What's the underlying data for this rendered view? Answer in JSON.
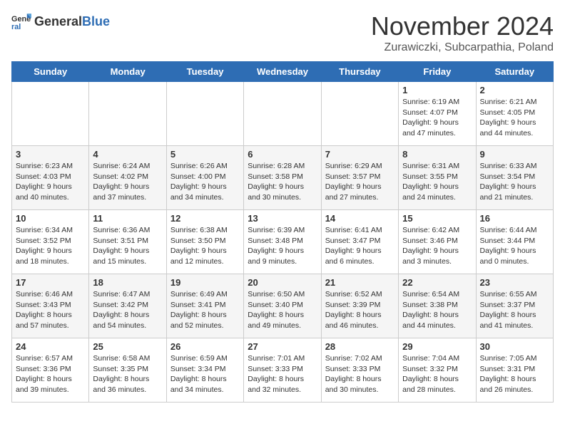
{
  "header": {
    "logo_general": "General",
    "logo_blue": "Blue",
    "month": "November 2024",
    "location": "Zurawiczki, Subcarpathia, Poland"
  },
  "days_of_week": [
    "Sunday",
    "Monday",
    "Tuesday",
    "Wednesday",
    "Thursday",
    "Friday",
    "Saturday"
  ],
  "weeks": [
    [
      {
        "day": "",
        "info": ""
      },
      {
        "day": "",
        "info": ""
      },
      {
        "day": "",
        "info": ""
      },
      {
        "day": "",
        "info": ""
      },
      {
        "day": "",
        "info": ""
      },
      {
        "day": "1",
        "info": "Sunrise: 6:19 AM\nSunset: 4:07 PM\nDaylight: 9 hours and 47 minutes."
      },
      {
        "day": "2",
        "info": "Sunrise: 6:21 AM\nSunset: 4:05 PM\nDaylight: 9 hours and 44 minutes."
      }
    ],
    [
      {
        "day": "3",
        "info": "Sunrise: 6:23 AM\nSunset: 4:03 PM\nDaylight: 9 hours and 40 minutes."
      },
      {
        "day": "4",
        "info": "Sunrise: 6:24 AM\nSunset: 4:02 PM\nDaylight: 9 hours and 37 minutes."
      },
      {
        "day": "5",
        "info": "Sunrise: 6:26 AM\nSunset: 4:00 PM\nDaylight: 9 hours and 34 minutes."
      },
      {
        "day": "6",
        "info": "Sunrise: 6:28 AM\nSunset: 3:58 PM\nDaylight: 9 hours and 30 minutes."
      },
      {
        "day": "7",
        "info": "Sunrise: 6:29 AM\nSunset: 3:57 PM\nDaylight: 9 hours and 27 minutes."
      },
      {
        "day": "8",
        "info": "Sunrise: 6:31 AM\nSunset: 3:55 PM\nDaylight: 9 hours and 24 minutes."
      },
      {
        "day": "9",
        "info": "Sunrise: 6:33 AM\nSunset: 3:54 PM\nDaylight: 9 hours and 21 minutes."
      }
    ],
    [
      {
        "day": "10",
        "info": "Sunrise: 6:34 AM\nSunset: 3:52 PM\nDaylight: 9 hours and 18 minutes."
      },
      {
        "day": "11",
        "info": "Sunrise: 6:36 AM\nSunset: 3:51 PM\nDaylight: 9 hours and 15 minutes."
      },
      {
        "day": "12",
        "info": "Sunrise: 6:38 AM\nSunset: 3:50 PM\nDaylight: 9 hours and 12 minutes."
      },
      {
        "day": "13",
        "info": "Sunrise: 6:39 AM\nSunset: 3:48 PM\nDaylight: 9 hours and 9 minutes."
      },
      {
        "day": "14",
        "info": "Sunrise: 6:41 AM\nSunset: 3:47 PM\nDaylight: 9 hours and 6 minutes."
      },
      {
        "day": "15",
        "info": "Sunrise: 6:42 AM\nSunset: 3:46 PM\nDaylight: 9 hours and 3 minutes."
      },
      {
        "day": "16",
        "info": "Sunrise: 6:44 AM\nSunset: 3:44 PM\nDaylight: 9 hours and 0 minutes."
      }
    ],
    [
      {
        "day": "17",
        "info": "Sunrise: 6:46 AM\nSunset: 3:43 PM\nDaylight: 8 hours and 57 minutes."
      },
      {
        "day": "18",
        "info": "Sunrise: 6:47 AM\nSunset: 3:42 PM\nDaylight: 8 hours and 54 minutes."
      },
      {
        "day": "19",
        "info": "Sunrise: 6:49 AM\nSunset: 3:41 PM\nDaylight: 8 hours and 52 minutes."
      },
      {
        "day": "20",
        "info": "Sunrise: 6:50 AM\nSunset: 3:40 PM\nDaylight: 8 hours and 49 minutes."
      },
      {
        "day": "21",
        "info": "Sunrise: 6:52 AM\nSunset: 3:39 PM\nDaylight: 8 hours and 46 minutes."
      },
      {
        "day": "22",
        "info": "Sunrise: 6:54 AM\nSunset: 3:38 PM\nDaylight: 8 hours and 44 minutes."
      },
      {
        "day": "23",
        "info": "Sunrise: 6:55 AM\nSunset: 3:37 PM\nDaylight: 8 hours and 41 minutes."
      }
    ],
    [
      {
        "day": "24",
        "info": "Sunrise: 6:57 AM\nSunset: 3:36 PM\nDaylight: 8 hours and 39 minutes."
      },
      {
        "day": "25",
        "info": "Sunrise: 6:58 AM\nSunset: 3:35 PM\nDaylight: 8 hours and 36 minutes."
      },
      {
        "day": "26",
        "info": "Sunrise: 6:59 AM\nSunset: 3:34 PM\nDaylight: 8 hours and 34 minutes."
      },
      {
        "day": "27",
        "info": "Sunrise: 7:01 AM\nSunset: 3:33 PM\nDaylight: 8 hours and 32 minutes."
      },
      {
        "day": "28",
        "info": "Sunrise: 7:02 AM\nSunset: 3:33 PM\nDaylight: 8 hours and 30 minutes."
      },
      {
        "day": "29",
        "info": "Sunrise: 7:04 AM\nSunset: 3:32 PM\nDaylight: 8 hours and 28 minutes."
      },
      {
        "day": "30",
        "info": "Sunrise: 7:05 AM\nSunset: 3:31 PM\nDaylight: 8 hours and 26 minutes."
      }
    ]
  ]
}
